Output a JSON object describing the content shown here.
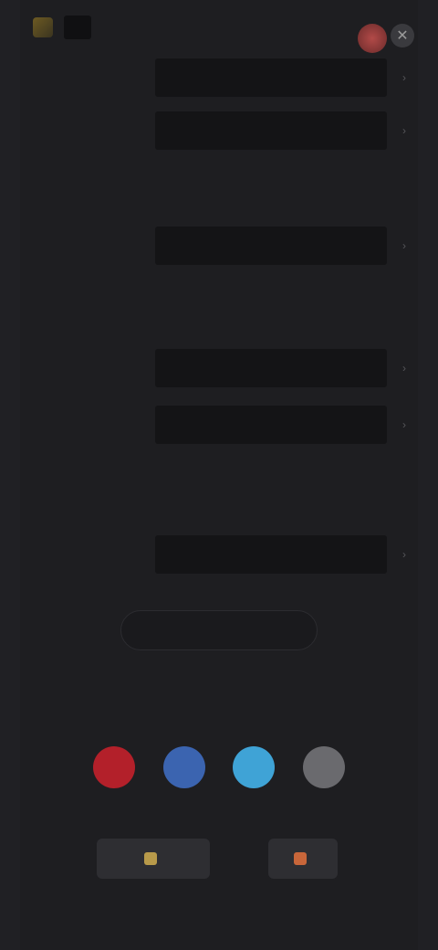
{
  "header": {
    "logo_text": "",
    "close_glyph": "✕"
  },
  "rows": [
    {
      "label": "",
      "field_value": ""
    },
    {
      "label": "",
      "field_value": ""
    },
    {
      "label": "",
      "field_value": ""
    },
    {
      "label": "",
      "field_value": ""
    },
    {
      "label": "",
      "field_value": ""
    },
    {
      "label": "",
      "field_value": ""
    }
  ],
  "sections": [
    {
      "title": ""
    },
    {
      "title": ""
    },
    {
      "title": ""
    }
  ],
  "cta": {
    "label": ""
  },
  "promo": {
    "gold_text": "",
    "blue_text": ""
  },
  "social": [
    {
      "icon": "youtube-icon",
      "color": "#b3202a",
      "glyph": ""
    },
    {
      "icon": "facebook-icon",
      "color": "#3b64b0",
      "glyph": ""
    },
    {
      "icon": "twitter-icon",
      "color": "#3fa3d6",
      "glyph": ""
    },
    {
      "icon": "email-icon",
      "color": "#6a6a6e",
      "glyph": ""
    }
  ],
  "stores": [
    {
      "label": "",
      "icon_color": "#b89a4a"
    },
    {
      "label": "",
      "icon_color": "#c8663a"
    }
  ],
  "colors": {
    "background": "#1c1c1f",
    "panel": "#1e1e21",
    "field": "#141416",
    "accent_gold": "#8a6a28"
  }
}
